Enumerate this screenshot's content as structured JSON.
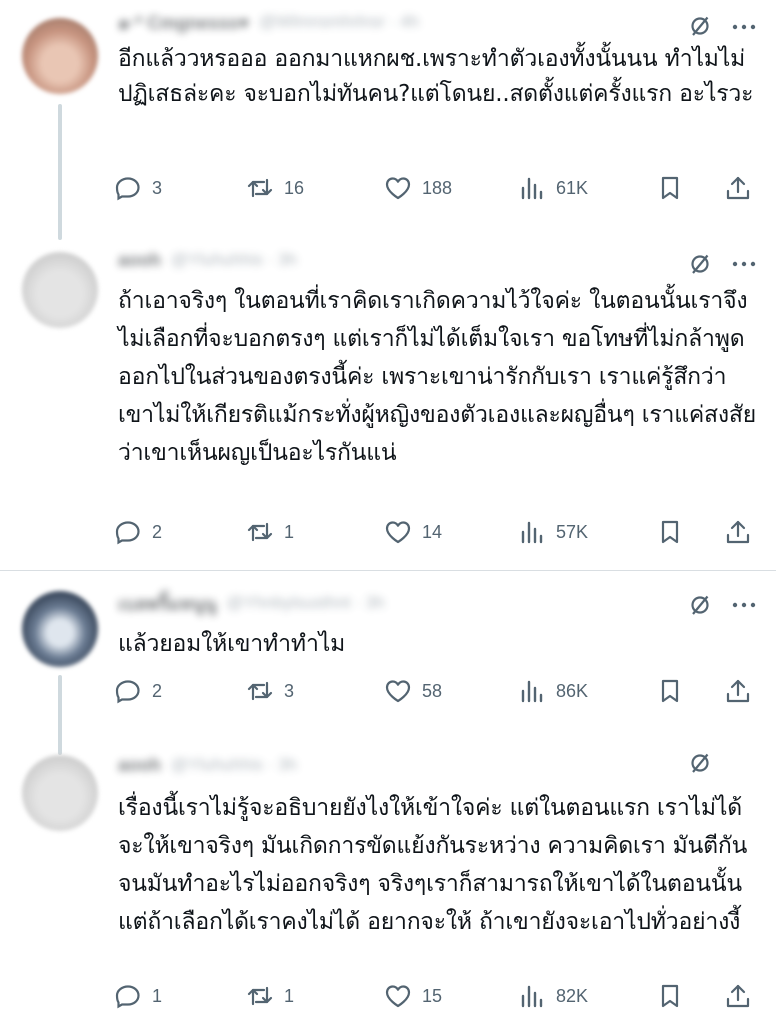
{
  "tweets": [
    {
      "display_name": "๑·* Cmgnesss♥",
      "handle": "@Wlmnsmhrlnsr · 4h",
      "text": "อีกแล้ววหรอออ ออกมาแหกผช.เพราะทำตัวเองทั้งนั้นนน ทำไมไม่ปฏิเสธล่ะคะ จะบอกไม่ทันคน?แต่โดนย..สดตั้งแต่ครั้งแรก อะไรวะ",
      "replies": "3",
      "reposts": "16",
      "likes": "188",
      "views": "61K"
    },
    {
      "display_name": "aooh",
      "handle": "@Yluhuhhis · 3h",
      "text": "ถ้าเอาจริงๆ ในตอนที่เราคิดเราเกิดความไว้ใจค่ะ ในตอนนั้นเราจึงไม่เลือกที่จะบอกตรงๆ แต่เราก็ไม่ได้เต็มใจเรา ขอโทษที่ไม่กล้าพูดออกไปในส่วนของตรงนี้ค่ะ เพราะเขาน่ารักกับเรา เราแค่รู้สึกว่าเขาไม่ให้เกียรติแม้กระทั่งผู้หญิงของตัวเองและผญอื่นๆ เราแค่สงสัยว่าเขาเห็นผญเป็นอะไรกันแน่",
      "replies": "2",
      "reposts": "1",
      "likes": "14",
      "views": "57K"
    },
    {
      "display_name": "เบลพริ้มหนูนู",
      "handle": "@Yhnbylsusthnt · 3h",
      "text": "แล้วยอมให้เขาทำทำไม",
      "replies": "2",
      "reposts": "3",
      "likes": "58",
      "views": "86K"
    },
    {
      "display_name": "aooh",
      "handle": "@Yluhuhhis · 3h",
      "text": "เรื่องนี้เราไม่รู้จะอธิบายยังไงให้เข้าใจค่ะ แต่ในตอนแรก เราไม่ได้จะให้เขาจริงๆ มันเกิดการขัดแย้งกันระหว่าง ความคิดเรา มันตีกันจนมันทำอะไรไม่ออกจริงๆ จริงๆเราก็สามารถให้เขาได้ในตอนนั้น แต่ถ้าเลือกได้เราคงไม่ได้ อยากจะให้ ถ้าเขายังจะเอาไปทั่วอย่างงี้",
      "replies": "1",
      "reposts": "1",
      "likes": "15",
      "views": "82K"
    }
  ],
  "icons": {
    "grok": "grok-icon",
    "more": "more-icon",
    "reply": "reply-icon",
    "repost": "repost-icon",
    "like": "like-icon",
    "views": "views-icon",
    "bookmark": "bookmark-icon",
    "share": "share-icon"
  },
  "colors": {
    "icon": "#536471",
    "text": "#0f1419",
    "thread_line": "#cfd9de",
    "divider": "#d9dee2"
  }
}
